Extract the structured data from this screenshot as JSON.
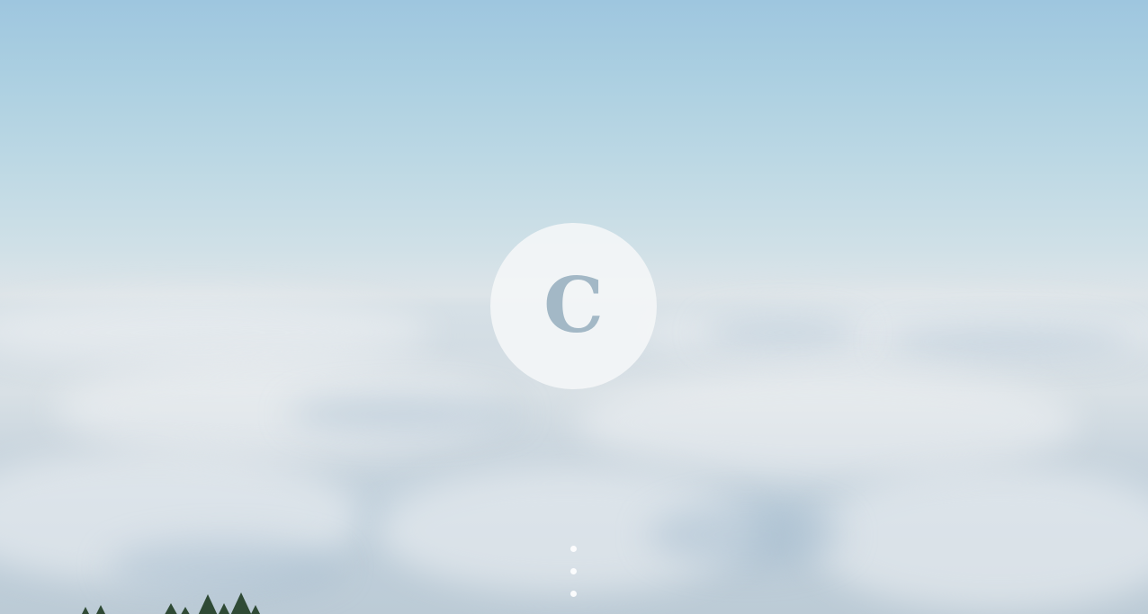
{
  "logo": {
    "letter": "C",
    "icon": "c-letter-logo-icon"
  },
  "nav_dots": {
    "count": 3,
    "icon": "dot-icon"
  },
  "colors": {
    "sky_top": "#9ec6df",
    "horizon": "#dde4e8",
    "cloud": "#e9ecef",
    "logo_circle": "#f4f6f7",
    "logo_letter": "#a3b8c6",
    "trees": "#2f4a35"
  }
}
